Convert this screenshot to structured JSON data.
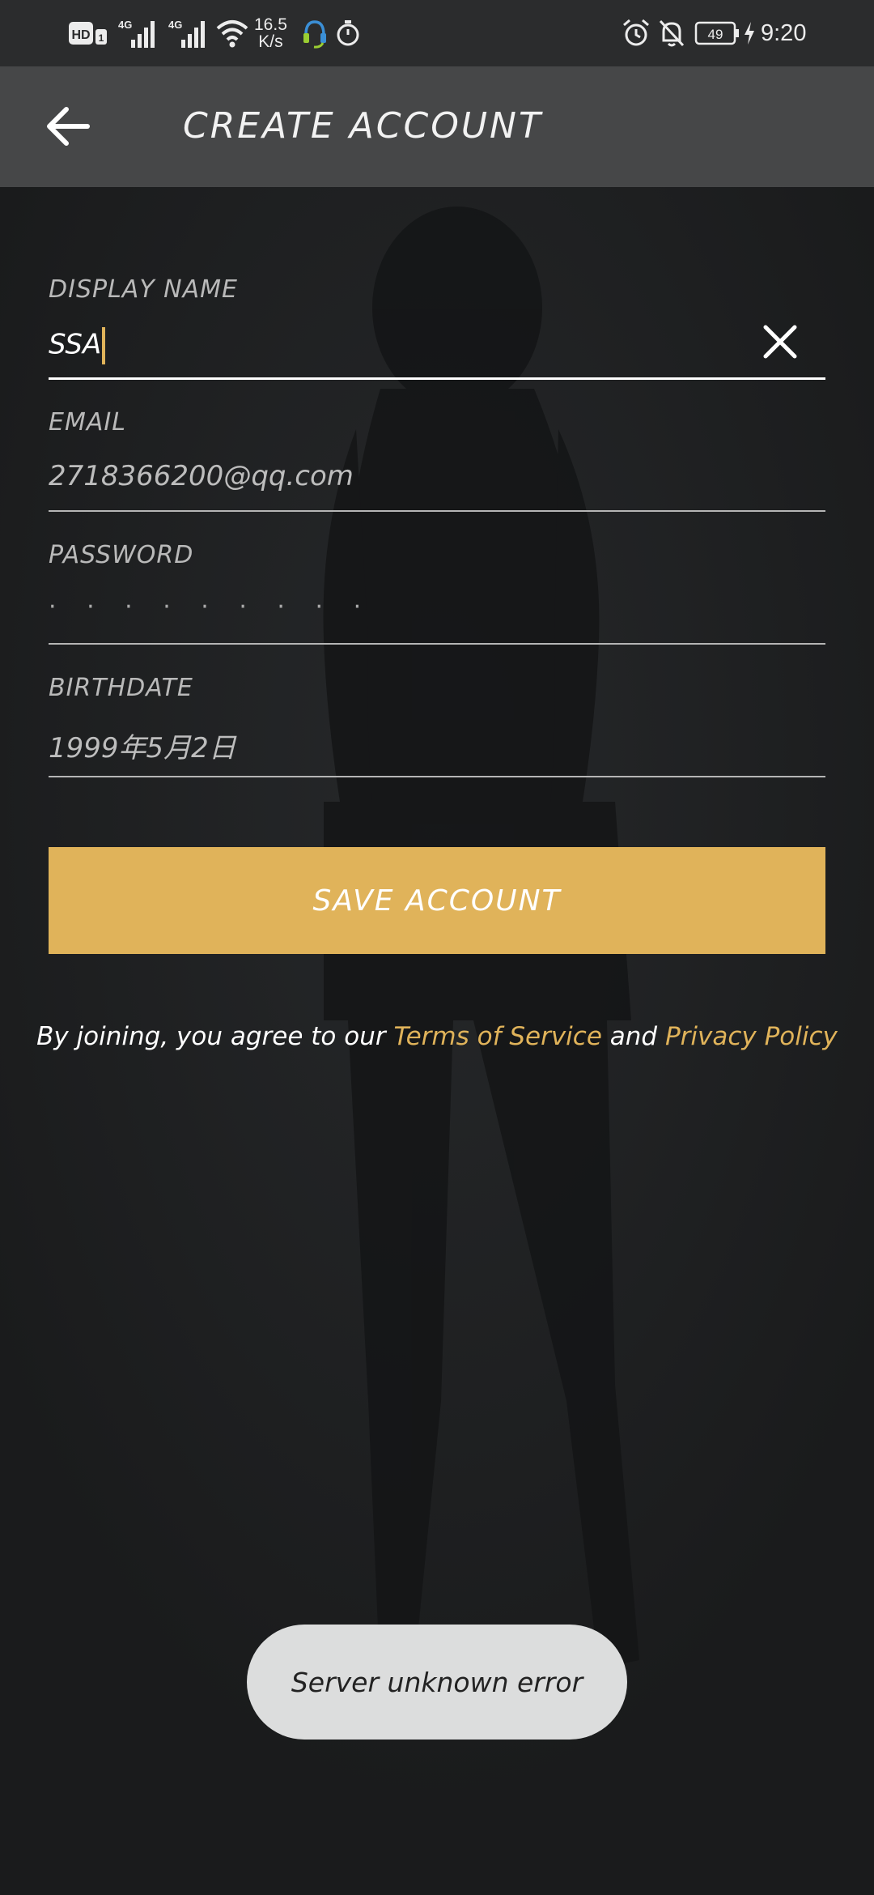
{
  "status_bar": {
    "hd_badge": "HD",
    "sim_index": "1",
    "network_1": "4G",
    "network_2": "4G",
    "net_speed_value": "16.5",
    "net_speed_unit": "K/s",
    "battery_level": "49",
    "time": "9:20",
    "icons": [
      "hd-icon",
      "signal-icon",
      "signal-icon",
      "wifi-icon",
      "headset-icon",
      "stopwatch-icon",
      "alarm-icon",
      "bell-off-icon",
      "battery-icon",
      "charging-bolt-icon"
    ]
  },
  "app_bar": {
    "title": "CREATE ACCOUNT",
    "back_icon": "arrow-left-icon"
  },
  "form": {
    "display_name": {
      "label": "DISPLAY NAME",
      "value": "SSA",
      "clear_icon": "close-icon"
    },
    "email": {
      "label": "EMAIL",
      "value": "2718366200@qq.com"
    },
    "password": {
      "label": "PASSWORD",
      "value": "· · · · · · · · ·"
    },
    "birthdate": {
      "label": "BIRTHDATE",
      "value": "1999年5月2日"
    }
  },
  "save_button": {
    "label": "SAVE ACCOUNT"
  },
  "terms": {
    "prefix": "By joining, you agree to our",
    "terms_link": "Terms of Service",
    "conjunction": "and",
    "privacy_link": "Privacy Policy"
  },
  "toast": {
    "message": "Server unknown error"
  },
  "colors": {
    "accent": "#e0b35a",
    "app_bar": "#464748",
    "status_bar": "#2b2c2d",
    "background": "#1c1e1f",
    "toast": "#dcdddd"
  }
}
